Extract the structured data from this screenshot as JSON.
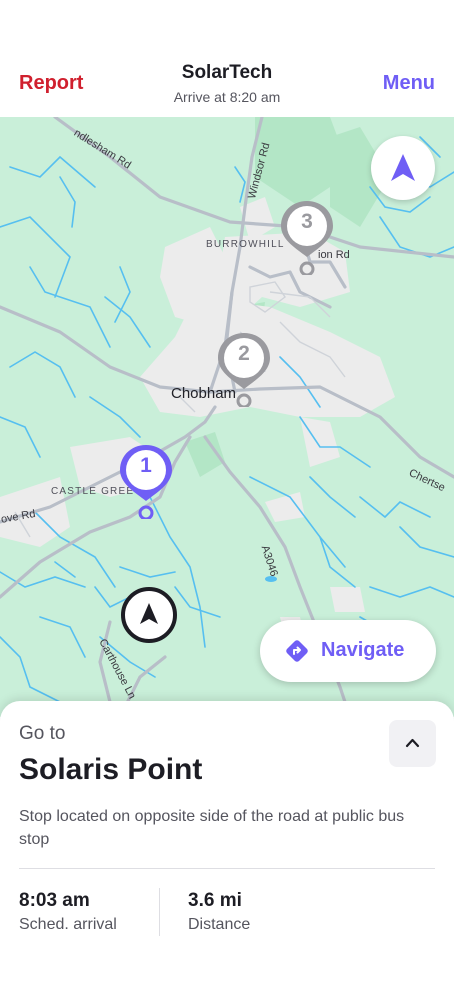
{
  "header": {
    "left_action": "Report",
    "title": "SolarTech",
    "subtitle": "Arrive at 8:20 am",
    "right_action": "Menu"
  },
  "colors": {
    "accent": "#6f5ef5",
    "danger": "#d0202e",
    "map_green": "#c9efd9",
    "map_grey_area": "#efefef",
    "water": "#56bff0",
    "inactive_pin": "#9a9a9f"
  },
  "map": {
    "labels": {
      "road_windlesham": "ndlesham Rd",
      "road_windsor": "Windsor Rd",
      "area_burrowhill": "BURROWHILL",
      "road_station": "ion Rd",
      "town_chobham": "Chobham",
      "area_castle_green": "CASTLE GREE",
      "road_grove": "ove Rd",
      "road_a3046": "A3046",
      "road_chertsey": "Chertse",
      "road_carthouse": "Carthouse Ln"
    },
    "stops": [
      {
        "number": "1",
        "state": "active"
      },
      {
        "number": "2",
        "state": "inactive"
      },
      {
        "number": "3",
        "state": "inactive"
      }
    ],
    "recenter_icon": "navigation-arrow-icon",
    "current_location_icon": "location-arrow-icon",
    "navigate_button": {
      "label": "Navigate",
      "icon": "turn-right-diamond-icon"
    }
  },
  "sheet": {
    "goto_label": "Go to",
    "destination": "Solaris Point",
    "note": "Stop located on opposite side of the road at public bus stop",
    "collapse_icon": "chevron-up-icon",
    "arrival_value": "8:03 am",
    "arrival_label": "Sched. arrival",
    "distance_value": "3.6 mi",
    "distance_label": "Distance"
  }
}
